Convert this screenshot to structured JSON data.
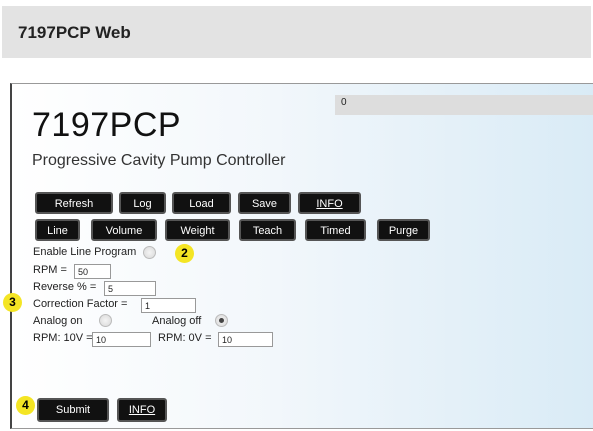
{
  "header": {
    "title": "7197PCP Web"
  },
  "app": {
    "title": "7197PCP",
    "subtitle": "Progressive Cavity Pump Controller",
    "progress": {
      "label": "0",
      "value": 0
    }
  },
  "toolbar": {
    "refresh_label": "Refresh",
    "log_label": "Log",
    "load_label": "Load",
    "save_label": "Save",
    "info_label": "INFO"
  },
  "program_tabs": {
    "line_label": "Line",
    "volume_label": "Volume",
    "weight_label": "Weight",
    "teach_label": "Teach",
    "timed_label": "Timed",
    "purge_label": "Purge"
  },
  "form": {
    "enable_line_program_label": "Enable Line Program",
    "enable_line_program_checked": false,
    "rpm_label": "RPM =",
    "rpm_value": "50",
    "reverse_label": "Reverse % =",
    "reverse_value": "5",
    "correction_label": "Correction Factor =",
    "correction_value": "1",
    "analog_on_label": "Analog on",
    "analog_off_label": "Analog off",
    "analog_selected": "off",
    "rpm10v_label": "RPM: 10V =",
    "rpm10v_value": "10",
    "rpm0v_label": "RPM: 0V =",
    "rpm0v_value": "10"
  },
  "footer": {
    "submit_label": "Submit",
    "info_label": "INFO"
  },
  "callouts": [
    "2",
    "3",
    "4"
  ],
  "colors": {
    "button_bg": "#111111",
    "callout": "#f4e524",
    "header_bg": "#e3e3e3"
  }
}
